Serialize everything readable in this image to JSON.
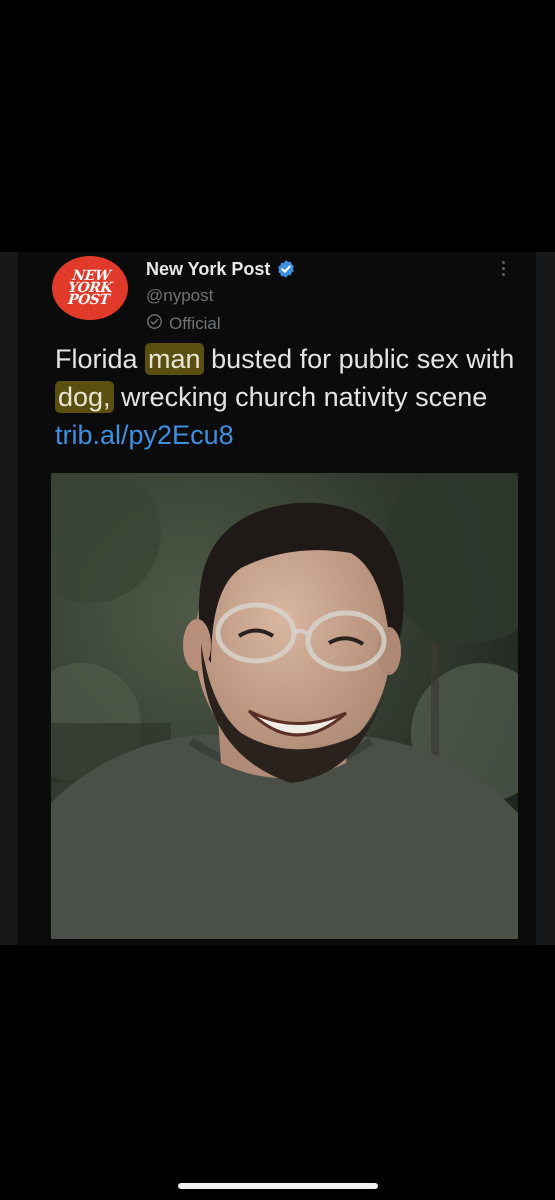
{
  "tweet": {
    "avatar_logo_text": "NEW\nYORK\nPOST",
    "display_name": "New York Post",
    "handle": "@nypost",
    "official_label": "Official",
    "text_parts": {
      "p1": "Florida ",
      "hl1": "man",
      "p2": " busted for public sex with ",
      "hl2": "dog,",
      "p3": " wrecking church nativity scene ",
      "link": "trib.al/py2Ecu8"
    },
    "verified_icon": "verified-badge-icon",
    "more_icon": "more-vertical-icon",
    "official_icon": "official-check-circle-icon"
  },
  "colors": {
    "background": "#000000",
    "card": "#0b0b0c",
    "avatar": "#e23a2a",
    "verified": "#3d8fe0",
    "highlight": "#5a4f0e",
    "link": "#3d8fe0",
    "muted_text": "#6e7277"
  }
}
